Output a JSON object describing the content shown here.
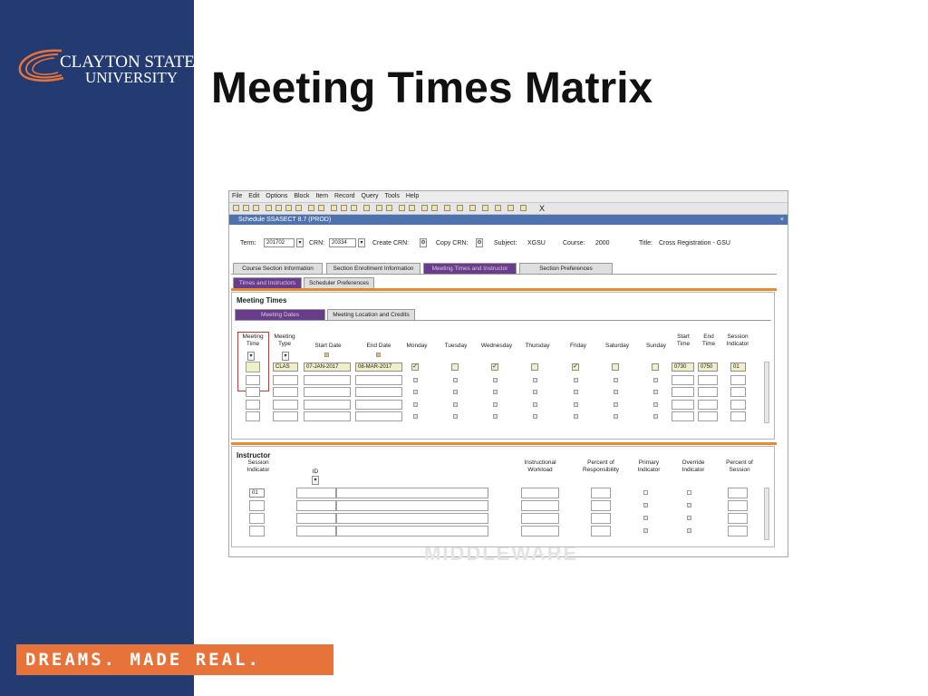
{
  "brand": {
    "logo_line1": "CLAYTON STATE",
    "logo_line2": "UNIVERSITY",
    "tagline": "DREAMS. MADE REAL.",
    "sidebar_color": "#243b72",
    "accent_color": "#e8733a"
  },
  "slide_title": "Meeting Times Matrix",
  "app": {
    "menu": [
      "File",
      "Edit",
      "Options",
      "Block",
      "Item",
      "Record",
      "Query",
      "Tools",
      "Help"
    ],
    "toolbar_close": "X",
    "window_title": "Schedule  SSASECT 8.7  (PROD)",
    "window_close": "×",
    "key_block": {
      "term_label": "Term:",
      "term_value": "201702",
      "crn_label": "CRN:",
      "crn_value": "20334",
      "create_crn_label": "Create CRN:",
      "copy_crn_label": "Copy CRN:",
      "subject_label": "Subject:",
      "subject_value": "XGSU",
      "course_label": "Course:",
      "course_value": "2000",
      "title_label": "Title:",
      "title_value": "Cross Registration - GSU"
    },
    "main_tabs": [
      "Course Section Information",
      "Section Enrollment Information",
      "Meeting Times and Instructor",
      "Section Preferences"
    ],
    "sub_tabs": [
      "Times and Instructors",
      "Scheduler Preferences"
    ],
    "meeting_times": {
      "heading": "Meeting Times",
      "tabs": [
        "Meeting Dates",
        "Meeting Location and Credits"
      ],
      "headers": {
        "meeting_time": "Meeting Time",
        "meeting_type": "Meeting Type",
        "start_date": "Start Date",
        "end_date": "End Date",
        "monday": "Monday",
        "tuesday": "Tuesday",
        "wednesday": "Wednesday",
        "thursday": "Thursday",
        "friday": "Friday",
        "saturday": "Saturday",
        "sunday": "Sunday",
        "start_time": "Start Time",
        "end_time": "End Time",
        "session_indicator": "Session Indicator"
      },
      "row1": {
        "meeting_type": "CLAS",
        "start_date": "07-JAN-2017",
        "end_date": "08-MAR-2017",
        "monday": "✓",
        "wednesday": "✓",
        "friday": "✓",
        "start_time": "0730",
        "end_time": "0750",
        "session_indicator": "01"
      }
    },
    "instructor": {
      "heading": "Instructor",
      "headers": {
        "session_indicator": "Session Indicator",
        "id": "ID",
        "instructional_workload": "Instructional Workload",
        "percent_responsibility": "Percent of Responsibility",
        "primary_indicator": "Primary Indicator",
        "override_indicator": "Override Indicator",
        "percent_session": "Percent of Session"
      },
      "row1_session": "01"
    },
    "watermark": "MIDDLEWARE"
  }
}
